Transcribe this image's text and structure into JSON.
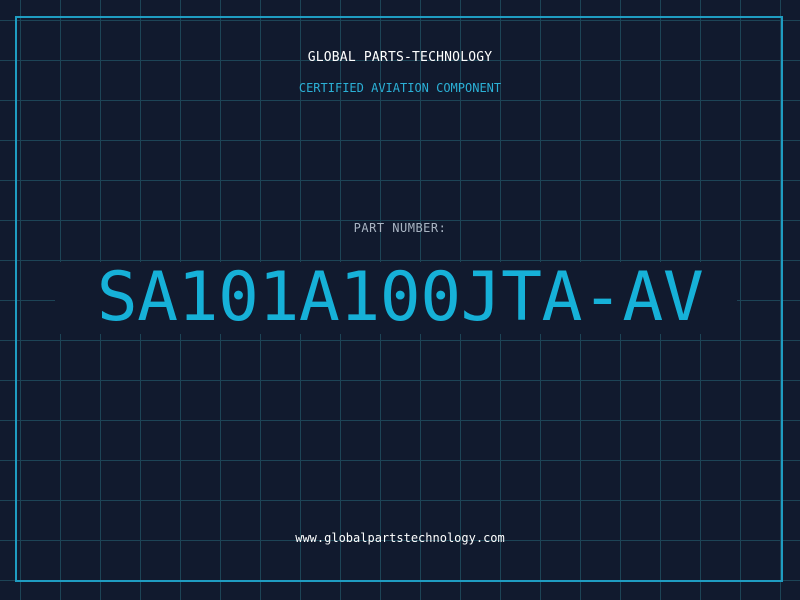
{
  "header": {
    "company": "GLOBAL PARTS-TECHNOLOGY",
    "tagline": "CERTIFIED AVIATION COMPONENT"
  },
  "part": {
    "label": "PART NUMBER:",
    "number": "SA101A100JTA-AV"
  },
  "footer": {
    "website": "www.globalpartstechnology.com"
  },
  "colors": {
    "background": "#111a2e",
    "grid": "#1d4456",
    "accent": "#16b1d8",
    "frame": "#1f9cc1"
  }
}
